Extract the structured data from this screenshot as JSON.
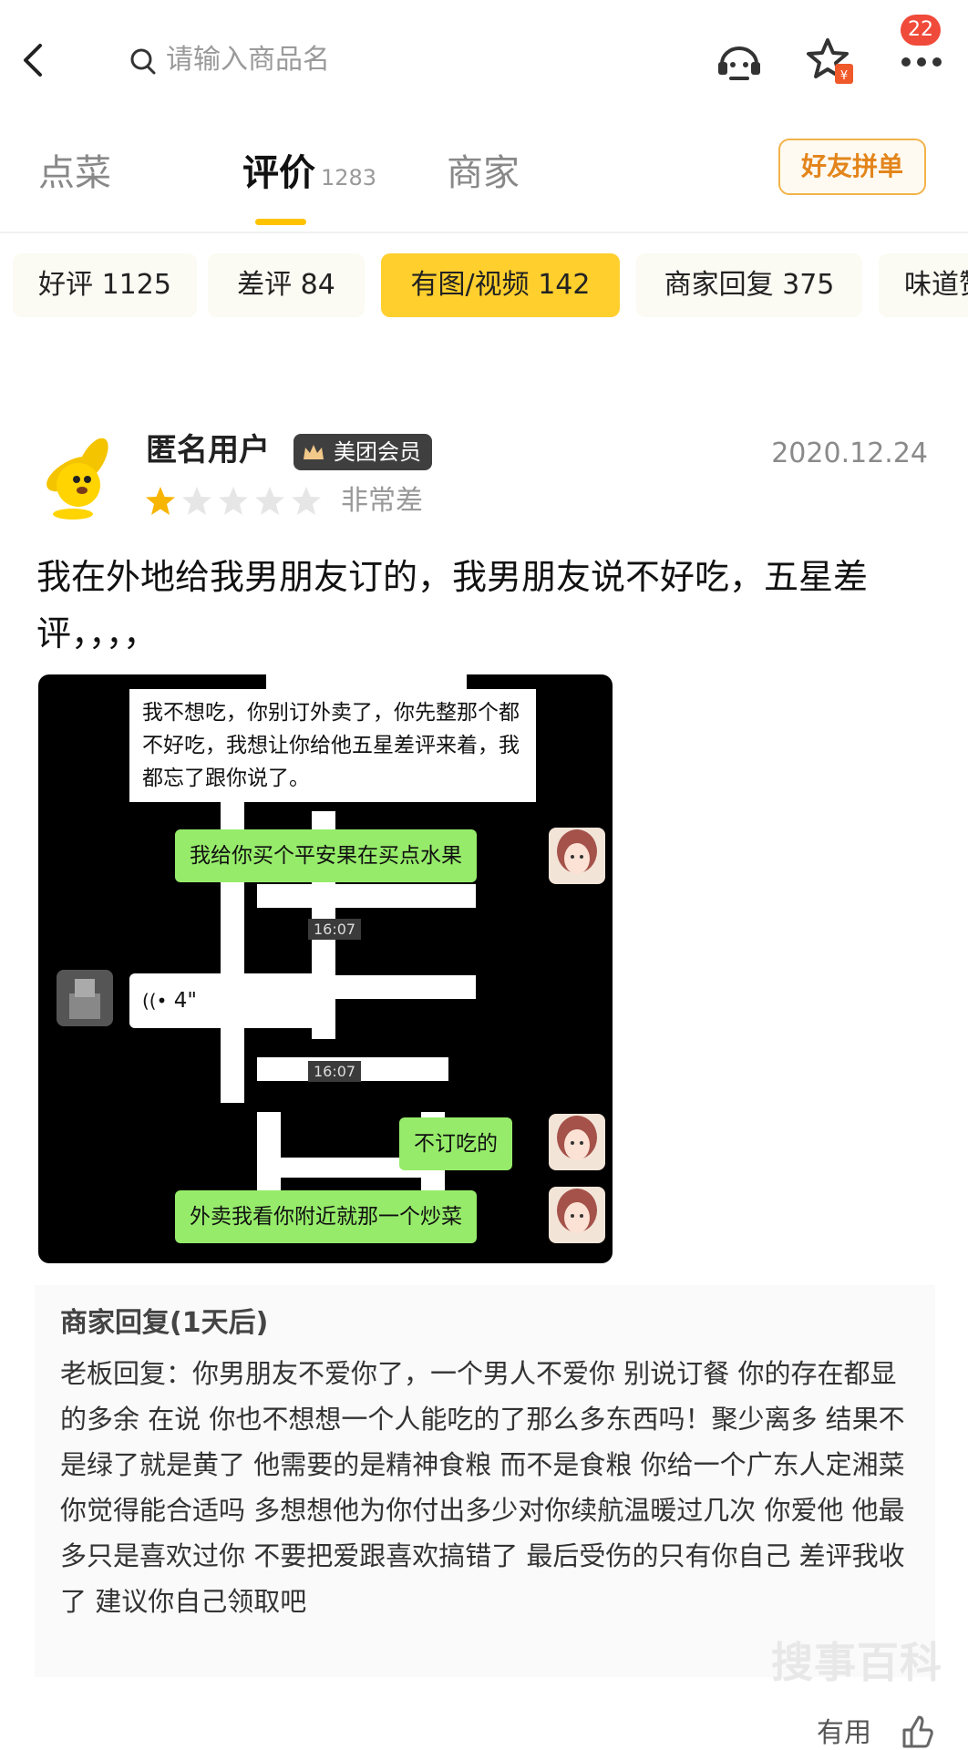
{
  "topbar": {
    "search_placeholder": "请输入商品名",
    "badge_count": "22",
    "icons": [
      "back-arrow-icon",
      "search-icon",
      "customer-service-icon",
      "favorite-star-icon",
      "more-icon"
    ]
  },
  "tabs": [
    {
      "label": "点菜"
    },
    {
      "label": "评价",
      "count": "1283",
      "active": true
    },
    {
      "label": "商家"
    }
  ],
  "group_order_button": "好友拼单",
  "filters": [
    {
      "label": "好评 1125"
    },
    {
      "label": "差评 84"
    },
    {
      "label": "有图/视频 142",
      "active": true
    },
    {
      "label": "商家回复 375"
    },
    {
      "label": "味道赞"
    }
  ],
  "review": {
    "username": "匿名用户",
    "member_badge": "美团会员",
    "date": "2020.12.24",
    "rating": 1,
    "rating_max": 5,
    "rating_text": "非常差",
    "text": "我在外地给我男朋友订的，我男朋友说不好吃，五星差评，，，，"
  },
  "chat": {
    "message_1": "我不想吃，你别订外卖了，你先整那个都不好吃，我想让你给他五星差评来着，我都忘了跟你说了。",
    "message_2": "我给你买个平安果在买点水果",
    "time_1": "16:07",
    "voice": "4\"",
    "time_2": "16:07",
    "message_3": "不订吃的",
    "message_4": "外卖我看你附近就那一个炒菜"
  },
  "merchant_reply": {
    "title": "商家回复(1天后)",
    "body": "老板回复：你男朋友不爱你了，一个男人不爱你 别说订餐 你的存在都显的多余   在说 你也不想想一个人能吃的了那么多东西吗！聚少离多 结果不是绿了就是黄了 他需要的是精神食粮 而不是食粮  你给一个广东人定湘菜 你觉得能合适吗 多想想他为你付出多少对你续航温暖过几次 你爱他 他最多只是喜欢过你 不要把爱跟喜欢搞错了 最后受伤的只有你自己 差评我收了 建议你自己领取吧"
  },
  "useful_label": "有用",
  "watermark": "搜事百科",
  "colors": {
    "accent": "#ffc300",
    "chip_active": "#ffcf2e",
    "green_bubble": "#96ec6a",
    "badge": "#f04a3a"
  }
}
